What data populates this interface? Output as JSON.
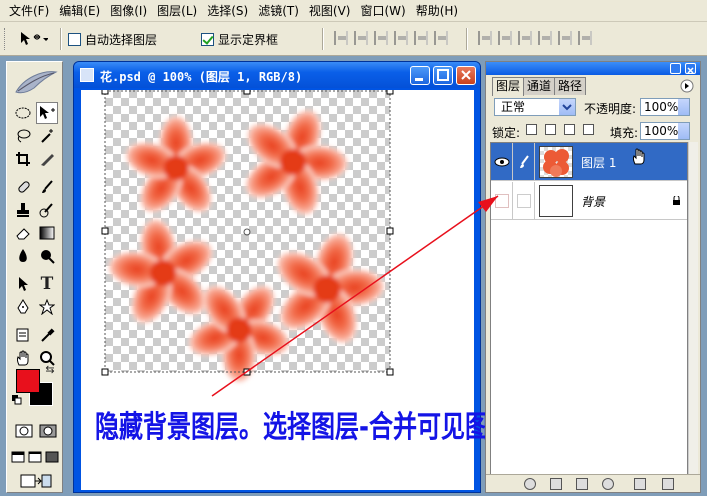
{
  "menu": [
    {
      "label": "文件(F)"
    },
    {
      "label": "编辑(E)"
    },
    {
      "label": "图像(I)"
    },
    {
      "label": "图层(L)"
    },
    {
      "label": "选择(S)"
    },
    {
      "label": "滤镜(T)"
    },
    {
      "label": "视图(V)"
    },
    {
      "label": "窗口(W)"
    },
    {
      "label": "帮助(H)"
    }
  ],
  "options": {
    "auto_select_label": "自动选择图层",
    "auto_select_checked": false,
    "show_bounds_label": "显示定界框",
    "show_bounds_checked": true
  },
  "document": {
    "title": "花.psd @ 100% (图层 1, RGB/8)",
    "annotation": "隐藏背景图层。选择图层-合并可见图层"
  },
  "layers_panel": {
    "tabs": [
      {
        "label": "图层"
      },
      {
        "label": "通道"
      },
      {
        "label": "路径"
      }
    ],
    "blend_mode": "正常",
    "opacity_label": "不透明度:",
    "opacity_value": "100%",
    "lock_label": "锁定:",
    "fill_label": "填充:",
    "fill_value": "100%",
    "layers": [
      {
        "name": "图层 1",
        "visible": true,
        "selected": true
      },
      {
        "name": "背景",
        "visible": false,
        "selected": false,
        "locked": true
      }
    ]
  },
  "colors": {
    "foreground": "#e8101c",
    "background": "#000000",
    "annotation_text": "#1414e6",
    "arrow": "#e8101c",
    "selection": "#316ac5"
  }
}
